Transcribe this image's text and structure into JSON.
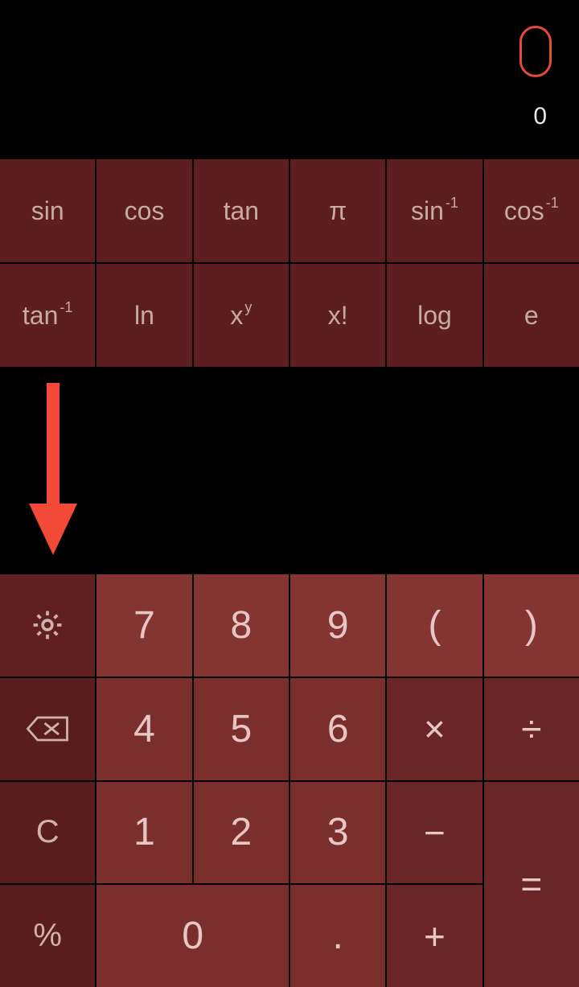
{
  "display": {
    "primary": "0",
    "secondary": "0"
  },
  "func_rows": [
    [
      {
        "name": "sin",
        "label": "sin",
        "super": ""
      },
      {
        "name": "cos",
        "label": "cos",
        "super": ""
      },
      {
        "name": "tan",
        "label": "tan",
        "super": ""
      },
      {
        "name": "pi",
        "label": "π",
        "super": ""
      },
      {
        "name": "asin",
        "label": "sin",
        "super": "-1"
      },
      {
        "name": "acos",
        "label": "cos",
        "super": "-1"
      }
    ],
    [
      {
        "name": "atan",
        "label": "tan",
        "super": "-1"
      },
      {
        "name": "ln",
        "label": "ln",
        "super": ""
      },
      {
        "name": "pow",
        "label": "x",
        "super": "y"
      },
      {
        "name": "fact",
        "label": "x!",
        "super": ""
      },
      {
        "name": "log",
        "label": "log",
        "super": ""
      },
      {
        "name": "e",
        "label": "e",
        "super": ""
      }
    ]
  ],
  "pad": {
    "row1": {
      "settings_icon": "gear",
      "n7": "7",
      "n8": "8",
      "n9": "9",
      "lp": "(",
      "rp": ")"
    },
    "row2": {
      "backspace_icon": "backspace",
      "n4": "4",
      "n5": "5",
      "n6": "6",
      "mul": "×",
      "div": "÷"
    },
    "row3": {
      "clear": "C",
      "n1": "1",
      "n2": "2",
      "n3": "3",
      "sub": "−",
      "eq": "="
    },
    "row4": {
      "pct": "%",
      "n0": "0",
      "dot": ".",
      "add": "+"
    }
  },
  "colors": {
    "accent": "#e34b3a",
    "arrow": "#f24a36",
    "key_num": "#7a2f2d",
    "key_func": "#5c1e1e",
    "key_util": "#591d1d",
    "key_op": "#6a2626"
  }
}
